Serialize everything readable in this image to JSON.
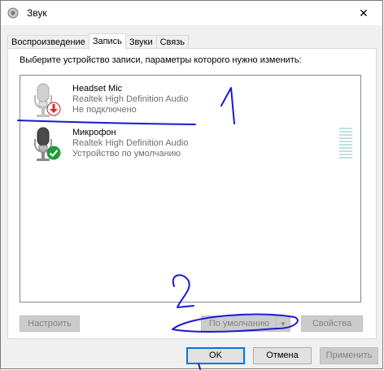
{
  "window": {
    "title": "Звук",
    "close_glyph": "✕"
  },
  "tabs": [
    {
      "label": "Воспроизведение",
      "active": false
    },
    {
      "label": "Запись",
      "active": true
    },
    {
      "label": "Звуки",
      "active": false
    },
    {
      "label": "Связь",
      "active": false
    }
  ],
  "panel": {
    "instruction": "Выберите устройство записи, параметры которого нужно изменить:"
  },
  "devices": [
    {
      "name": "Headset Mic",
      "driver": "Realtek High Definition Audio",
      "status": "Не подключено",
      "icon": "microphone-icon",
      "badge_icon": "disconnected-arrow-icon",
      "badge_color": "#d32f2f"
    },
    {
      "name": "Микрофон",
      "driver": "Realtek High Definition Audio",
      "status": "Устройство по умолчанию",
      "icon": "microphone-icon",
      "badge_icon": "checkmark-icon",
      "badge_color": "#1e9c3c"
    }
  ],
  "panel_buttons": {
    "configure": "Настроить",
    "set_default": "По умолчанию",
    "properties": "Свойства"
  },
  "dialog_buttons": {
    "ok": "OK",
    "cancel": "Отмена",
    "apply": "Применить"
  },
  "annotations": {
    "color": "#1a1ad0",
    "mark_1": "1",
    "mark_2": "2"
  }
}
